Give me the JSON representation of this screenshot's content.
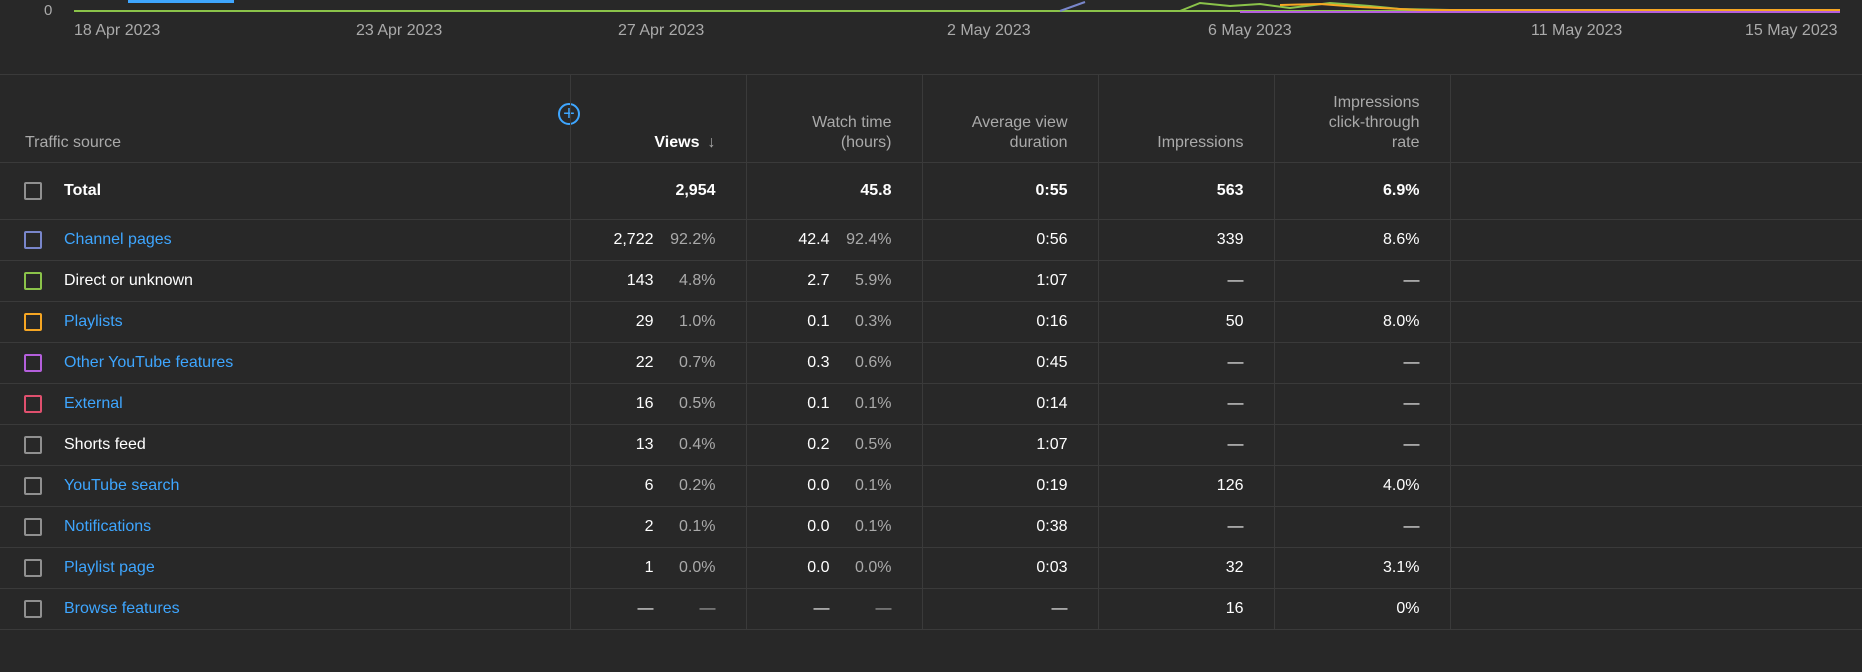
{
  "chart": {
    "y_tick": "0",
    "x_ticks": [
      {
        "label": "18 Apr 2023"
      },
      {
        "label": "23 Apr 2023"
      },
      {
        "label": "27 Apr 2023"
      },
      {
        "label": "2 May 2023"
      },
      {
        "label": "6 May 2023"
      },
      {
        "label": "11 May 2023"
      },
      {
        "label": "15 May 2023"
      }
    ]
  },
  "table": {
    "headers": {
      "source": "Traffic source",
      "views": "Views",
      "views_sort_icon": "arrow-down-icon",
      "watch_time_1": "Watch time",
      "watch_time_2": "(hours)",
      "avd_1": "Average view",
      "avd_2": "duration",
      "impressions": "Impressions",
      "ctr_1": "Impressions",
      "ctr_2": "click-through",
      "ctr_3": "rate"
    },
    "total": {
      "label": "Total",
      "views": "2,954",
      "watch": "45.8",
      "avd": "0:55",
      "impressions": "563",
      "ctr": "6.9%"
    },
    "rows": [
      {
        "label": "Channel pages",
        "color": "#7986cb",
        "link": true,
        "views": "2,722",
        "views_pct": "92.2%",
        "watch": "42.4",
        "watch_pct": "92.4%",
        "avd": "0:56",
        "impressions": "339",
        "ctr": "8.6%"
      },
      {
        "label": "Direct or unknown",
        "color": "#8bc34a",
        "link": false,
        "views": "143",
        "views_pct": "4.8%",
        "watch": "2.7",
        "watch_pct": "5.9%",
        "avd": "1:07",
        "impressions": "—",
        "ctr": "—"
      },
      {
        "label": "Playlists",
        "color": "#f6a623",
        "link": true,
        "views": "29",
        "views_pct": "1.0%",
        "watch": "0.1",
        "watch_pct": "0.3%",
        "avd": "0:16",
        "impressions": "50",
        "ctr": "8.0%"
      },
      {
        "label": "Other YouTube features",
        "color": "#b45fdc",
        "link": true,
        "views": "22",
        "views_pct": "0.7%",
        "watch": "0.3",
        "watch_pct": "0.6%",
        "avd": "0:45",
        "impressions": "—",
        "ctr": "—"
      },
      {
        "label": "External",
        "color": "#e0506e",
        "link": true,
        "views": "16",
        "views_pct": "0.5%",
        "watch": "0.1",
        "watch_pct": "0.1%",
        "avd": "0:14",
        "impressions": "—",
        "ctr": "—"
      },
      {
        "label": "Shorts feed",
        "color": "#909090",
        "link": false,
        "views": "13",
        "views_pct": "0.4%",
        "watch": "0.2",
        "watch_pct": "0.5%",
        "avd": "1:07",
        "impressions": "—",
        "ctr": "—"
      },
      {
        "label": "YouTube search",
        "color": "#909090",
        "link": true,
        "views": "6",
        "views_pct": "0.2%",
        "watch": "0.0",
        "watch_pct": "0.1%",
        "avd": "0:19",
        "impressions": "126",
        "ctr": "4.0%"
      },
      {
        "label": "Notifications",
        "color": "#909090",
        "link": true,
        "views": "2",
        "views_pct": "0.1%",
        "watch": "0.0",
        "watch_pct": "0.1%",
        "avd": "0:38",
        "impressions": "—",
        "ctr": "—"
      },
      {
        "label": "Playlist page",
        "color": "#909090",
        "link": true,
        "views": "1",
        "views_pct": "0.0%",
        "watch": "0.0",
        "watch_pct": "0.0%",
        "avd": "0:03",
        "impressions": "32",
        "ctr": "3.1%"
      },
      {
        "label": "Browse features",
        "color": "#909090",
        "link": true,
        "views": "—",
        "views_pct": "—",
        "watch": "—",
        "watch_pct": "—",
        "avd": "—",
        "impressions": "16",
        "ctr": "0%"
      }
    ]
  },
  "add_metric_icon": "plus-circle-icon"
}
